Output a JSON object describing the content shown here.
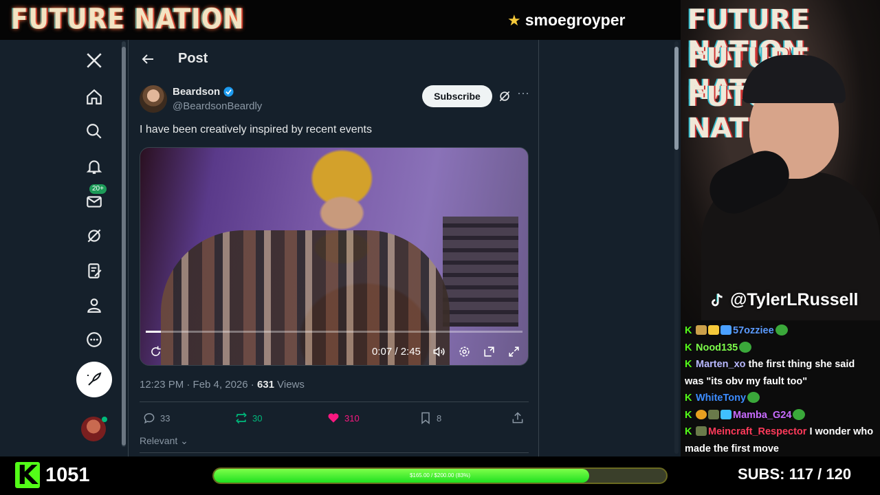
{
  "overlay": {
    "brand": "FUTURE NATION",
    "channel": "smoegroyper",
    "webcam_logo_rows": [
      "FUTURE NATION",
      "FUTURE NATION",
      "FUTURE NATION"
    ],
    "tiktok_handle": "@TylerLRussell",
    "follower_count": "1051",
    "goal_text": "$165.00 / $200.00 (83%)",
    "goal_fraction": 0.83,
    "subs_label": "SUBS:",
    "subs_value": "117 / 120",
    "kick_color": "#53fc18"
  },
  "nav": {
    "icons": [
      "x-logo-icon",
      "home-icon",
      "search-icon",
      "notifications-icon",
      "messages-icon",
      "grok-icon",
      "premium-icon",
      "profile-icon",
      "more-icon"
    ],
    "messages_badge": "20+",
    "post_button_icon": "compose-icon"
  },
  "post": {
    "header_title": "Post",
    "author_name": "Beardson",
    "author_handle": "@BeardsonBeardly",
    "subscribe_label": "Subscribe",
    "text": "I have been creatively inspired by recent events",
    "video_time": "0:07 / 2:45",
    "video_progress": 0.04,
    "timestamp": "12:23 PM · Feb 4, 2026 · ",
    "views_count": "631",
    "views_label": " Views",
    "replies": "33",
    "reposts": "30",
    "likes": "310",
    "bookmarks": "8",
    "sort_label": "Relevant",
    "accent_repost": "#00ba7c",
    "accent_like": "#f91880",
    "verified_color": "#1d9bf0"
  },
  "chat": [
    {
      "user": "57ozziee",
      "color": "#5b9bff",
      "message": ""
    },
    {
      "user": "Nood135",
      "color": "#7cfc4a",
      "message": ""
    },
    {
      "user": "Marten_xo",
      "color": "#b8b8ff",
      "message": " the first thing she said was \"its obv my fault too\""
    },
    {
      "user": "WhiteTony",
      "color": "#3c8cff",
      "message": ""
    },
    {
      "user": "Mamba_G24",
      "color": "#c86bff",
      "message": ""
    },
    {
      "user": "Meincraft_Respector",
      "color": "#ff3a5a",
      "message": " I wonder who made the first move"
    }
  ]
}
